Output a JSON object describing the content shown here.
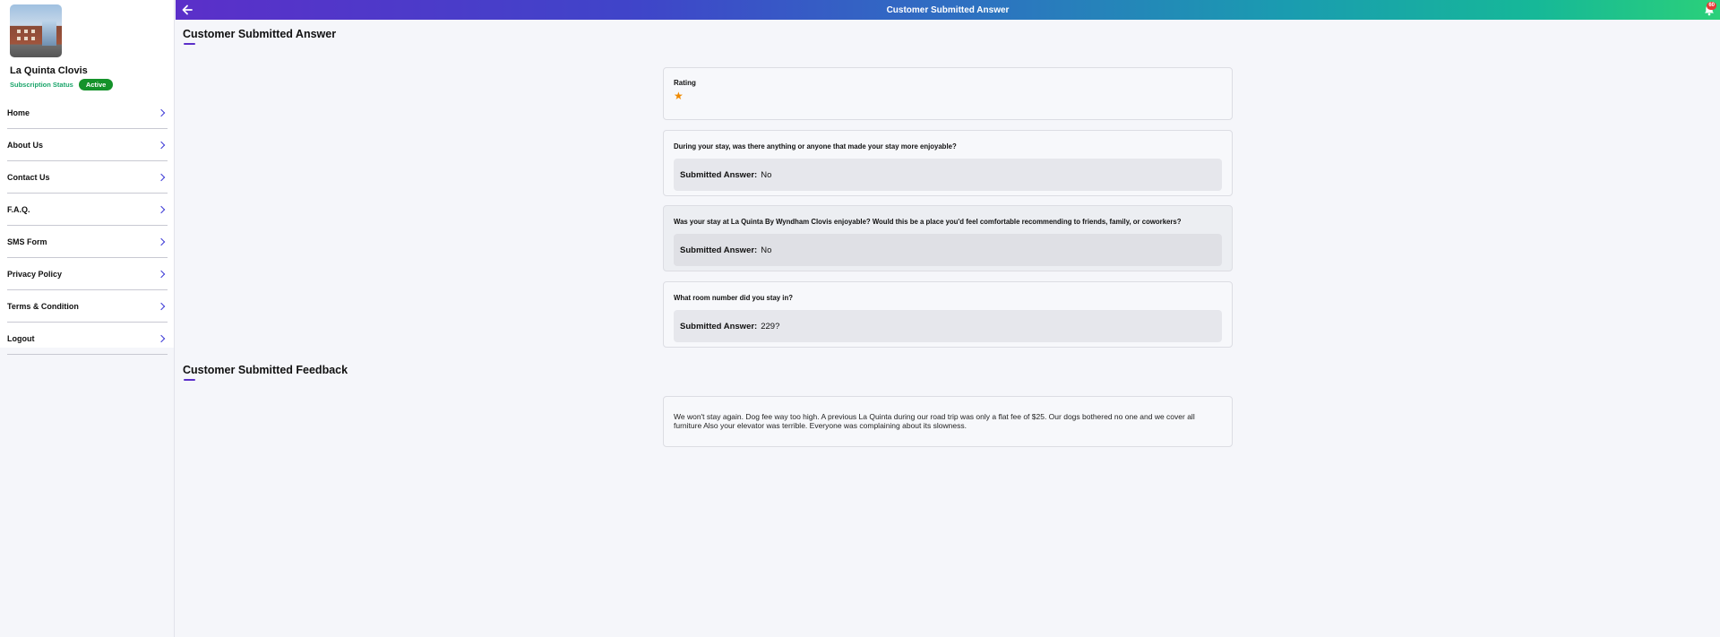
{
  "sidebar": {
    "hotel_name": "La Quinta Clovis",
    "subscription_label": "Subscription Status",
    "subscription_status": "Active",
    "items": [
      {
        "label": "Home"
      },
      {
        "label": "About Us"
      },
      {
        "label": "Contact Us"
      },
      {
        "label": "F.A.Q."
      },
      {
        "label": "SMS Form"
      },
      {
        "label": "Privacy Policy"
      },
      {
        "label": "Terms & Condition"
      },
      {
        "label": "Logout"
      }
    ]
  },
  "header": {
    "title": "Customer Submitted Answer",
    "notification_count": "60"
  },
  "answers_section": {
    "title": "Customer Submitted Answer",
    "rating_label": "Rating",
    "rating_stars": "★",
    "answer_prefix": "Submitted Answer:",
    "questions": [
      {
        "question": "During your stay, was there anything or anyone that made your stay more enjoyable?",
        "answer": "No"
      },
      {
        "question": "Was your stay at La Quinta By Wyndham Clovis enjoyable? Would this be a place you'd feel comfortable recommending to friends, family, or coworkers?",
        "answer": "No"
      },
      {
        "question": "What room number did you stay in?",
        "answer": "229?"
      }
    ]
  },
  "feedback_section": {
    "title": "Customer Submitted Feedback",
    "text": "We won't stay again. Dog fee way too high. A previous La Quinta during our road trip was only a flat fee of $25. Our dogs bothered no one and we cover all furniture Also your elevator was terrible. Everyone was complaining about its slowness."
  },
  "colors": {
    "accent": "#5b2fc9",
    "active_badge": "#14922a",
    "star": "#f08a00",
    "subscription_label": "#1aa56a"
  }
}
